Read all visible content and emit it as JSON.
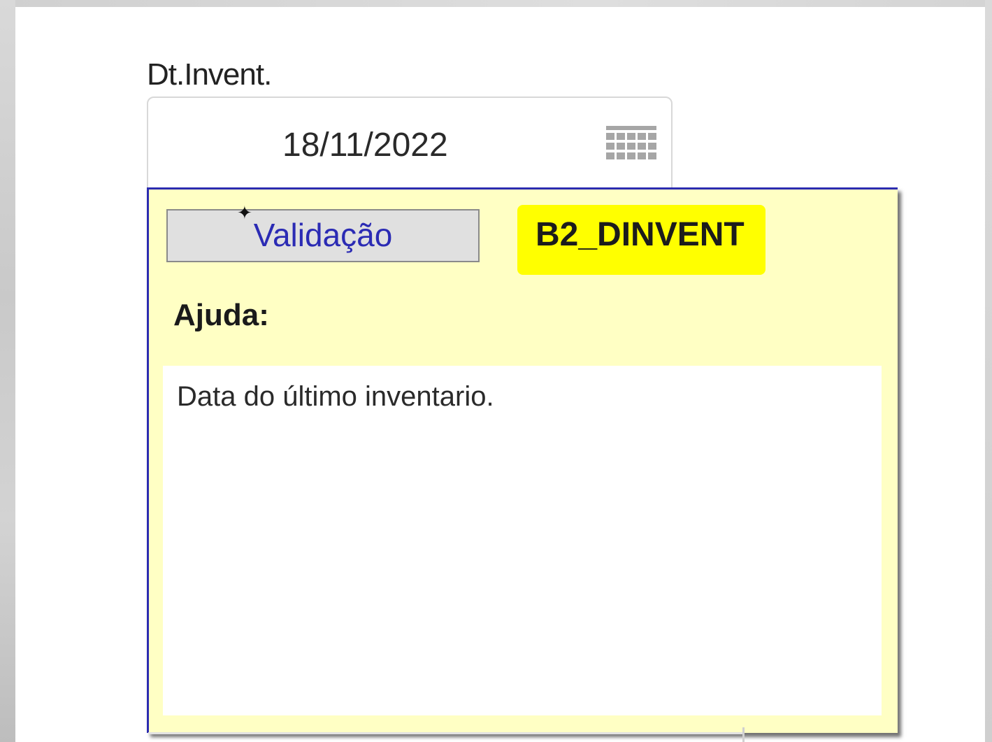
{
  "field": {
    "label": "Dt.Invent.",
    "value": "18/11/2022",
    "calendar_icon": "calendar-grid-icon"
  },
  "tooltip": {
    "tab_label": "Validação",
    "field_id": "B2_DINVENT",
    "help_heading": "Ajuda:",
    "help_text": "Data do último inventario.",
    "colors": {
      "background": "#ffffc4",
      "border": "#2c2cb0",
      "field_id_highlight": "#ffff00",
      "tab_text": "#2b2bb4"
    }
  }
}
